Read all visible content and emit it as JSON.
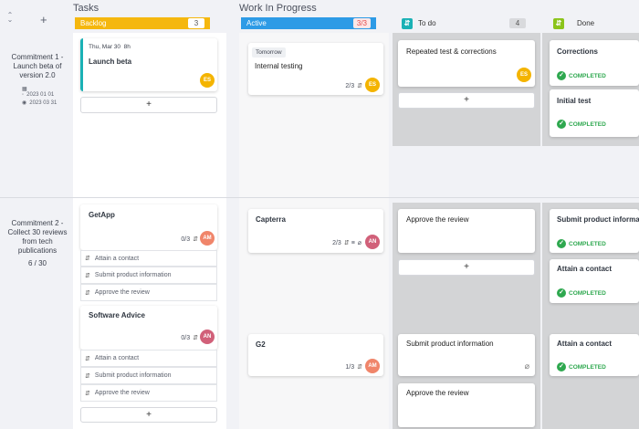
{
  "groups": {
    "tasks": "Tasks",
    "wip": "Work In Progress"
  },
  "columns": {
    "backlog": {
      "label": "Backlog",
      "count": "3",
      "color": "#f5b70e"
    },
    "active": {
      "label": "Active",
      "count": "3/3",
      "color": "#2d9be6"
    },
    "todo": {
      "label": "To do",
      "count": "4",
      "color": "#1ab1b5"
    },
    "done": {
      "label": "Done",
      "color": "#8bc41a"
    }
  },
  "lanes": [
    {
      "title": "Commitment 1 - Launch beta of version 2.0",
      "start": "2023 01 01",
      "end": "2023 03 31"
    },
    {
      "title": "Commitment 2 - Collect 30 reviews from tech publications",
      "progress": "6 / 30"
    }
  ],
  "cards": {
    "launch_beta": {
      "date": "Thu, Mar 30",
      "duration": "8h",
      "title": "Launch beta",
      "avatar": "ES"
    },
    "internal_testing": {
      "date": "Tomorrow",
      "title": "Internal testing",
      "subtasks": "2/3",
      "avatar": "ES"
    },
    "repeated_test": {
      "title": "Repeated test & corrections",
      "avatar": "ES"
    },
    "corrections": {
      "title": "Corrections",
      "status": "COMPLETED"
    },
    "initial_test": {
      "title": "Initial test",
      "status": "COMPLETED"
    },
    "getapp": {
      "title": "GetApp",
      "subtasks": "0/3",
      "avatar": "AM",
      "items": [
        "Attain a contact",
        "Submit product information",
        "Approve the review"
      ]
    },
    "capterra": {
      "title": "Capterra",
      "subtasks": "2/3",
      "avatar": "AN"
    },
    "approve_review": {
      "title": "Approve the review"
    },
    "submit_product": {
      "title": "Submit product informatio",
      "status": "COMPLETED"
    },
    "attain_contact": {
      "title": "Attain a contact",
      "status": "COMPLETED"
    },
    "software_advice": {
      "title": "Software Advice",
      "subtasks": "0/3",
      "avatar": "AN",
      "items": [
        "Attain a contact",
        "Submit product information",
        "Approve the review"
      ]
    },
    "g2": {
      "title": "G2",
      "subtasks": "1/3",
      "avatar": "AM"
    },
    "submit_product_2": {
      "title": "Submit product information"
    },
    "approve_review_2": {
      "title": "Approve the review"
    },
    "attain_contact_2": {
      "title": "Attain a contact",
      "status": "COMPLETED"
    }
  },
  "add_label": "+",
  "icons": {
    "collapse": "collapse-icon",
    "plus": "plus-icon",
    "calendar": "calendar-icon",
    "subtasks": "subtasks-icon",
    "list": "list-icon",
    "attachment": "attachment-icon",
    "check": "check-icon"
  }
}
